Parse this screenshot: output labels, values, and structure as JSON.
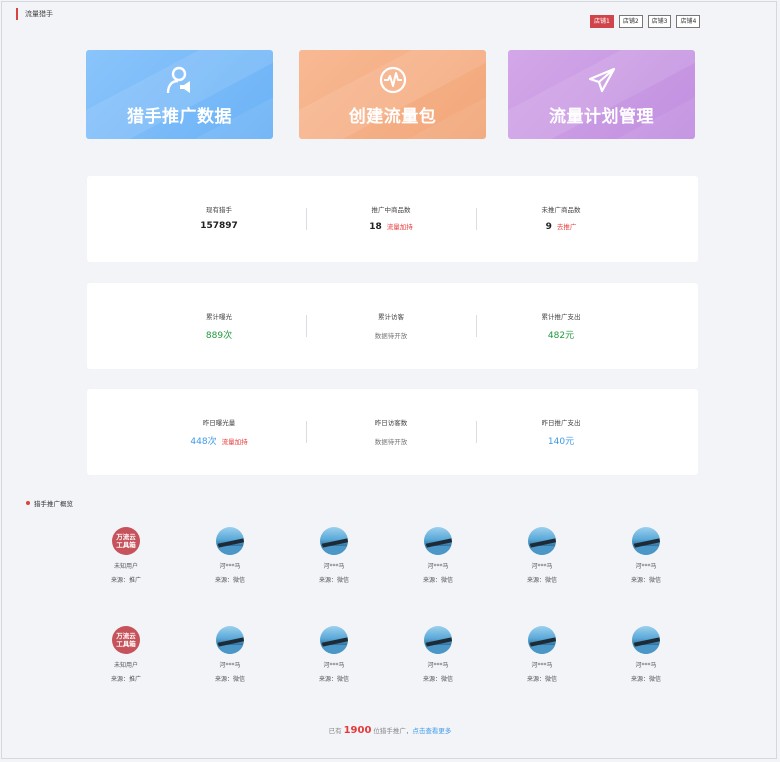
{
  "header": {
    "title": "流量猎手"
  },
  "shops": [
    "店铺1",
    "店铺2",
    "店铺3",
    "店铺4"
  ],
  "features": [
    {
      "label": "猎手推广数据",
      "icon": "user-megaphone-icon",
      "color": "#7cbbf9"
    },
    {
      "label": "创建流量包",
      "icon": "pulse-circle-icon",
      "color": "#f5b087"
    },
    {
      "label": "流量计划管理",
      "icon": "paper-plane-icon",
      "color": "#ca9ae4"
    }
  ],
  "stats_row1": {
    "hunters": {
      "label": "现有猎手",
      "value": "157897"
    },
    "promoting": {
      "label": "推广中商品数",
      "value": "18",
      "action": "流量加持"
    },
    "not_promoted": {
      "label": "未推广商品数",
      "value": "9",
      "action": "去推广"
    }
  },
  "stats_row2": {
    "impressions": {
      "label": "累计曝光",
      "value": "889次"
    },
    "visitors": {
      "label": "累计访客",
      "value": "数据待开放"
    },
    "spend": {
      "label": "累计推广支出",
      "value": "482元"
    }
  },
  "stats_row3": {
    "impressions": {
      "label": "昨日曝光量",
      "value": "448次",
      "action": "流量加持"
    },
    "visitors": {
      "label": "昨日访客数",
      "value": "数据待开放"
    },
    "spend": {
      "label": "昨日推广支出",
      "value": "140元"
    }
  },
  "overview": {
    "title": "猎手推广概览",
    "brand_avatar_text": "万流云工具箱",
    "rows": [
      [
        {
          "name": "未知用户",
          "source": "来源：推广",
          "avatar": "brand"
        },
        {
          "name": "河***马",
          "source": "来源：微信",
          "avatar": "photo"
        },
        {
          "name": "河***马",
          "source": "来源：微信",
          "avatar": "photo"
        },
        {
          "name": "河***马",
          "source": "来源：微信",
          "avatar": "photo"
        },
        {
          "name": "河***马",
          "source": "来源：微信",
          "avatar": "photo"
        },
        {
          "name": "河***马",
          "source": "来源：微信",
          "avatar": "photo"
        }
      ],
      [
        {
          "name": "未知用户",
          "source": "来源：推广",
          "avatar": "brand"
        },
        {
          "name": "河***马",
          "source": "来源：微信",
          "avatar": "photo"
        },
        {
          "name": "河***马",
          "source": "来源：微信",
          "avatar": "photo"
        },
        {
          "name": "河***马",
          "source": "来源：微信",
          "avatar": "photo"
        },
        {
          "name": "河***马",
          "source": "来源：微信",
          "avatar": "photo"
        },
        {
          "name": "河***马",
          "source": "来源：微信",
          "avatar": "photo"
        }
      ]
    ]
  },
  "footer": {
    "prefix": "已有",
    "count": "1900",
    "suffix": "位猎手推广，",
    "more": "点击查看更多"
  },
  "colors": {
    "accent_red": "#d8433f",
    "value_green": "#1f9a3c",
    "value_blue": "#3d9ae8",
    "link_red": "#e53a3a"
  }
}
